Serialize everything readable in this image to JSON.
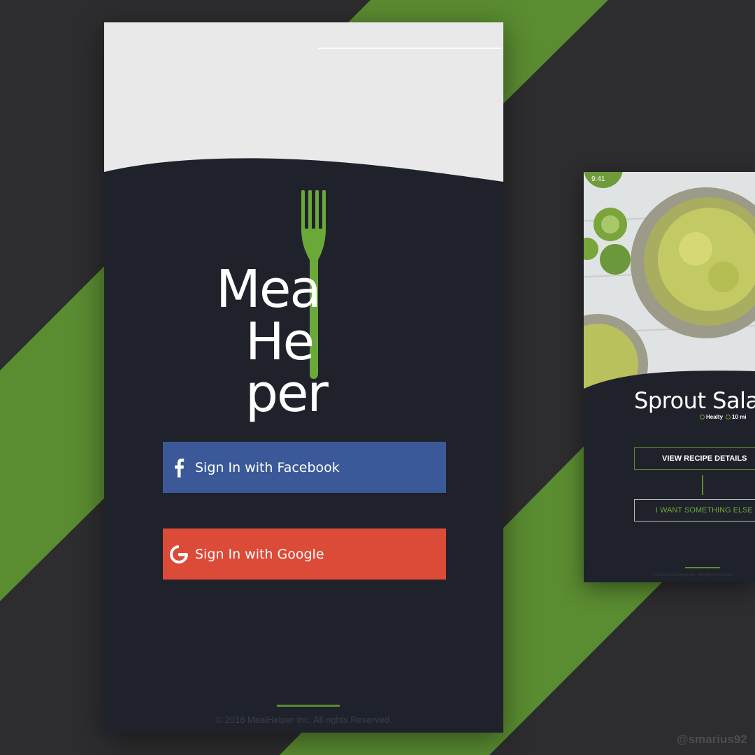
{
  "colors": {
    "background": "#2d2d2f",
    "accent_green": "#5a8c31",
    "phone_dark": "#1f222b",
    "facebook_blue": "#3b5998",
    "google_red": "#dc4a38"
  },
  "main_screen": {
    "logo": {
      "line1": "Mea",
      "line2": "He",
      "line2_end": "per",
      "icon": "fork-icon"
    },
    "facebook_button": {
      "label": "Sign In with Facebook",
      "icon": "facebook-icon"
    },
    "google_button": {
      "label": "Sign In with Google",
      "icon": "google-icon"
    },
    "copyright": "© 2018 MealHelper Inc. All rights Reserved."
  },
  "recipe_screen": {
    "status_time": "9:41",
    "title": "Sprout Salad",
    "tags": [
      {
        "label": "Healty",
        "icon": "smile-icon"
      },
      {
        "label": "10 mi",
        "icon": "clock-icon"
      }
    ],
    "view_button": "VIEW RECIPE DETAILS",
    "else_button": "I WANT SOMETHING ELSE",
    "copyright": "© 2018 MealHelper Inc. All rights Reserved."
  },
  "watermark": "@smarius92"
}
